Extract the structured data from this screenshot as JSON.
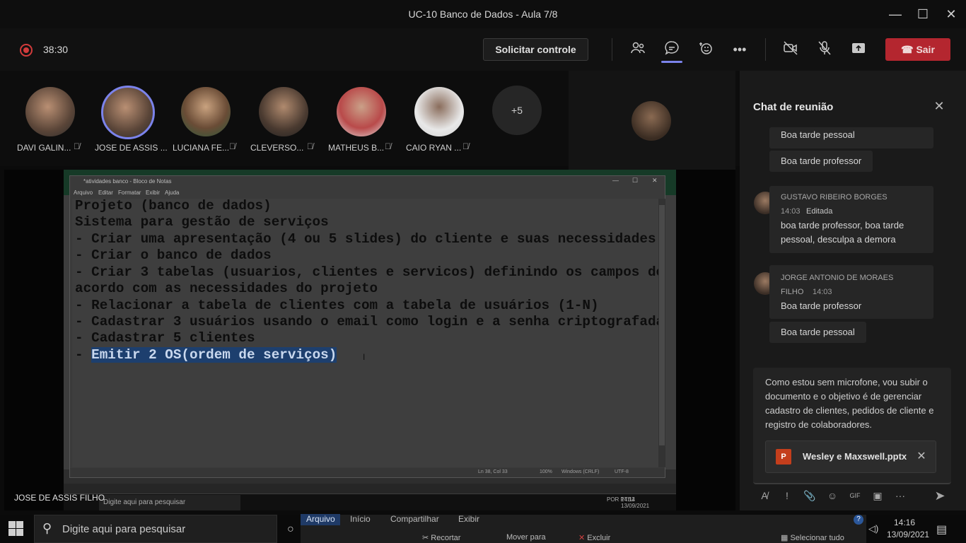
{
  "window": {
    "title": "UC-10 Banco de Dados - Aula 7/8",
    "minimize": "—",
    "maximize": "☐",
    "close": "✕"
  },
  "toolbar": {
    "recording_time": "38:30",
    "request_control": "Solicitar controle",
    "leave": "Sair"
  },
  "participants": [
    {
      "name": "DAVI GALIN..."
    },
    {
      "name": "JOSE DE ASSIS ..."
    },
    {
      "name": "LUCIANA FE..."
    },
    {
      "name": "CLEVERSO..."
    },
    {
      "name": "MATHEUS B..."
    },
    {
      "name": "CAIO RYAN ..."
    }
  ],
  "more_participants": "+5",
  "notepad": {
    "title": "*atividades banco - Bloco de Notas",
    "menu": [
      "Arquivo",
      "Editar",
      "Formatar",
      "Exibir",
      "Ajuda"
    ],
    "lines": [
      "Projeto (banco de dados)",
      "Sistema para gestão de serviços",
      "- Criar uma apresentação (4 ou 5 slides) do cliente e suas necessidades",
      "- Criar o banco de dados",
      "- Criar 3 tabelas (usuarios, clientes e servicos) definindo os campos de",
      "acordo com as necessidades do projeto",
      "- Relacionar a tabela de clientes com a tabela de usuários (1-N)",
      "- Cadastrar 3 usuários usando o email como login e a senha criptografada",
      "- Cadastrar 5 clientes"
    ],
    "last_line_prefix": "- ",
    "last_line_selected": "Emitir 2 OS(ordem de serviços)",
    "status": {
      "position": "Ln 38, Col 33",
      "zoom": "100%",
      "eol": "Windows (CRLF)",
      "encoding": "UTF-8"
    }
  },
  "inner_taskbar": {
    "search": "Digite aqui para pesquisar",
    "lang": "POR PTB2",
    "time": "14:14",
    "date": "13/09/2021"
  },
  "sharer_label": "JOSE DE ASSIS FILHO",
  "chat": {
    "title": "Chat de reunião",
    "messages_top": [
      "Boa tarde pessoal",
      "Boa tarde professor"
    ],
    "gustavo": {
      "name": "GUSTAVO RIBEIRO BORGES",
      "time": "14:03",
      "edited": "Editada",
      "text_line1": "boa tarde professor, boa tarde",
      "text_line2": "pessoal, desculpa a demora"
    },
    "jorge": {
      "name_line1": "JORGE ANTONIO DE MORAES",
      "name_line2": "FILHO",
      "time": "14:03",
      "text": "Boa tarde professor",
      "text2": "Boa tarde pessoal"
    },
    "compose": {
      "text": "Como estou sem microfone, vou subir o documento e o objetivo é de gerenciar cadastro de clientes, pedidos de cliente e registro de colaboradores.",
      "attachment": "Wesley e Maxswell.pptx"
    }
  },
  "taskbar": {
    "search_placeholder": "Digite aqui para pesquisar",
    "ribbon_tabs": [
      "Arquivo",
      "Início",
      "Compartilhar",
      "Exibir"
    ],
    "ribbon_cmds": [
      "Recortar",
      "Mover para",
      "Excluir",
      "Selecionar tudo"
    ],
    "time": "14:16",
    "date": "13/09/2021"
  },
  "colors": {
    "leave": "#b4262f",
    "accent": "#7b83eb",
    "presence_busy": "#c4314b"
  }
}
